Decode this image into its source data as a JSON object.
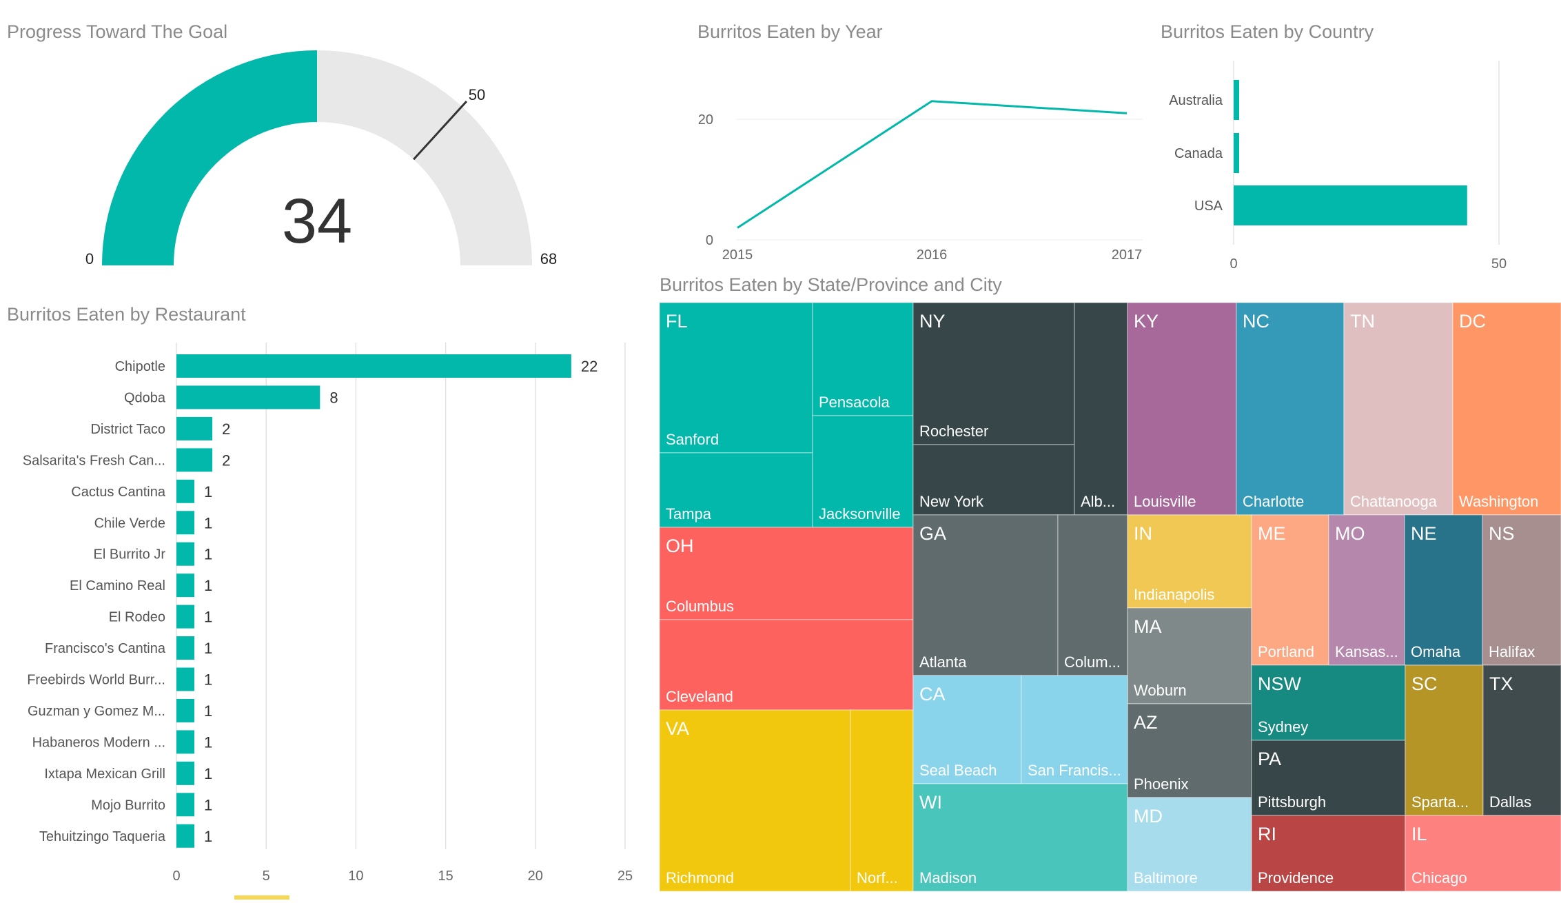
{
  "colors": {
    "accent": "#01b8aa",
    "track": "#e8e8e8",
    "needle": "#333333",
    "grid": "#e3e3e3"
  },
  "gauge": {
    "title": "Progress Toward The Goal",
    "value": 34,
    "min": 0,
    "max": 68,
    "target": 50,
    "value_label": "34",
    "min_label": "0",
    "max_label": "68",
    "target_label": "50"
  },
  "chart_data": [
    {
      "type": "line",
      "title": "Burritos Eaten by Year",
      "x": [
        "2015",
        "2016",
        "2017"
      ],
      "values": [
        2,
        23,
        21
      ],
      "ylim": [
        0,
        25
      ],
      "yticks": [
        "0",
        "20"
      ]
    },
    {
      "type": "bar",
      "orientation": "horizontal",
      "title": "Burritos Eaten by Country",
      "categories": [
        "Australia",
        "Canada",
        "USA"
      ],
      "values": [
        1,
        1,
        44
      ],
      "xlim": [
        0,
        50
      ],
      "xticks": [
        "0",
        "50"
      ]
    },
    {
      "type": "bar",
      "orientation": "horizontal",
      "title": "Burritos Eaten by Restaurant",
      "categories": [
        "Chipotle",
        "Qdoba",
        "District Taco",
        "Salsarita's Fresh Can...",
        "Cactus Cantina",
        "Chile Verde",
        "El Burrito Jr",
        "El Camino Real",
        "El Rodeo",
        "Francisco's Cantina",
        "Freebirds World Burr...",
        "Guzman y Gomez M...",
        "Habaneros Modern ...",
        "Ixtapa Mexican Grill",
        "Mojo Burrito",
        "Tehuitzingo Taqueria"
      ],
      "values": [
        22,
        8,
        2,
        2,
        1,
        1,
        1,
        1,
        1,
        1,
        1,
        1,
        1,
        1,
        1,
        1
      ],
      "value_labels": [
        "22",
        "8",
        "2",
        "2",
        "1",
        "1",
        "1",
        "1",
        "1",
        "1",
        "1",
        "1",
        "1",
        "1",
        "1",
        "1"
      ],
      "xlim": [
        0,
        25
      ],
      "xticks": [
        "0",
        "5",
        "10",
        "15",
        "20",
        "25"
      ]
    },
    {
      "type": "treemap",
      "title": "Burritos Eaten by State/Province and City",
      "groups": [
        {
          "state": "FL",
          "color": "#01b8aa",
          "cities": [
            "Sanford",
            "Tampa",
            "Pensacola",
            "Jacksonville"
          ]
        },
        {
          "state": "NY",
          "color": "#374649",
          "cities": [
            "Rochester",
            "New York",
            "Alb..."
          ]
        },
        {
          "state": "KY",
          "color": "#a66999",
          "cities": [
            "Louisville"
          ]
        },
        {
          "state": "NC",
          "color": "#3599b8",
          "cities": [
            "Charlotte"
          ]
        },
        {
          "state": "TN",
          "color": "#dfbfbf",
          "cities": [
            "Chattanooga"
          ]
        },
        {
          "state": "DC",
          "color": "#fe9666",
          "cities": [
            "Washington"
          ]
        },
        {
          "state": "OH",
          "color": "#fd625e",
          "cities": [
            "Columbus",
            "Cleveland"
          ]
        },
        {
          "state": "GA",
          "color": "#5f6b6d",
          "cities": [
            "Atlanta",
            "Colum..."
          ]
        },
        {
          "state": "IN",
          "color": "#f2c855",
          "cities": [
            "Indianapolis"
          ]
        },
        {
          "state": "ME",
          "color": "#fea783",
          "cities": [
            "Portland"
          ]
        },
        {
          "state": "MO",
          "color": "#b687ac",
          "cities": [
            "Kansas..."
          ]
        },
        {
          "state": "NE",
          "color": "#28738a",
          "cities": [
            "Omaha"
          ]
        },
        {
          "state": "NS",
          "color": "#a78f8f",
          "cities": [
            "Halifax"
          ]
        },
        {
          "state": "MA",
          "color": "#7f898a",
          "cities": [
            "Woburn"
          ]
        },
        {
          "state": "NSW",
          "color": "#168980",
          "cities": [
            "Sydney"
          ]
        },
        {
          "state": "SC",
          "color": "#b59525",
          "cities": [
            "Sparta..."
          ]
        },
        {
          "state": "TX",
          "color": "#404b4e",
          "cities": [
            "Dallas"
          ]
        },
        {
          "state": "VA",
          "color": "#f2c80f",
          "cities": [
            "Richmond",
            "Norf..."
          ]
        },
        {
          "state": "CA",
          "color": "#8ad4eb",
          "cities": [
            "Seal Beach",
            "San Francis..."
          ]
        },
        {
          "state": "AZ",
          "color": "#5f6b6d",
          "cities": [
            "Phoenix"
          ]
        },
        {
          "state": "PA",
          "color": "#374649",
          "cities": [
            "Pittsburgh"
          ]
        },
        {
          "state": "WI",
          "color": "#4ac5bb",
          "cities": [
            "Madison"
          ]
        },
        {
          "state": "MD",
          "color": "#a7dcec",
          "cities": [
            "Baltimore"
          ]
        },
        {
          "state": "RI",
          "color": "#b94545",
          "cities": [
            "Providence"
          ]
        },
        {
          "state": "IL",
          "color": "#fd817e",
          "cities": [
            "Chicago"
          ]
        }
      ]
    }
  ]
}
